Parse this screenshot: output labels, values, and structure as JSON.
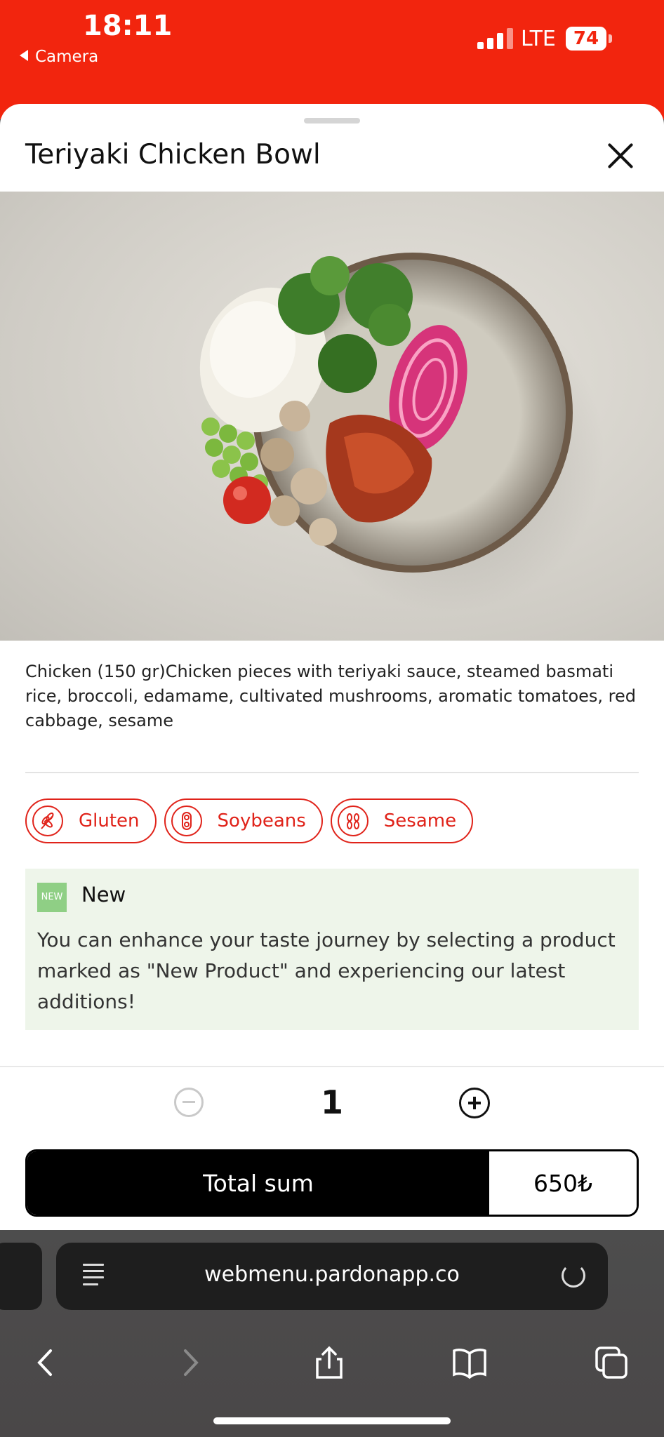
{
  "status_bar": {
    "time": "18:11",
    "back_app": "Camera",
    "network": "LTE",
    "battery": "74"
  },
  "product": {
    "title": "Teriyaki Chicken Bowl",
    "description": "Chicken (150 gr)Chicken pieces with teriyaki sauce, steamed basmati rice, broccoli, edamame, cultivated mushrooms, aromatic tomatoes, red cabbage, sesame",
    "allergens": [
      {
        "label": "Gluten",
        "icon": "wheat-icon"
      },
      {
        "label": "Soybeans",
        "icon": "soybean-icon"
      },
      {
        "label": "Sesame",
        "icon": "sesame-icon"
      }
    ],
    "new_notice": {
      "badge": "NEW",
      "title": "New",
      "text": "You can enhance your taste journey by selecting a product marked as \"New Product\" and experiencing our latest additions!"
    }
  },
  "order": {
    "quantity": "1",
    "total_label": "Total sum",
    "total_value": "650₺"
  },
  "browser": {
    "url": "webmenu.pardonapp.co"
  },
  "colors": {
    "brand_red": "#f2250e",
    "allergen_red": "#e0231a",
    "new_green": "#8fcf85",
    "new_bg": "#eef5ea"
  }
}
